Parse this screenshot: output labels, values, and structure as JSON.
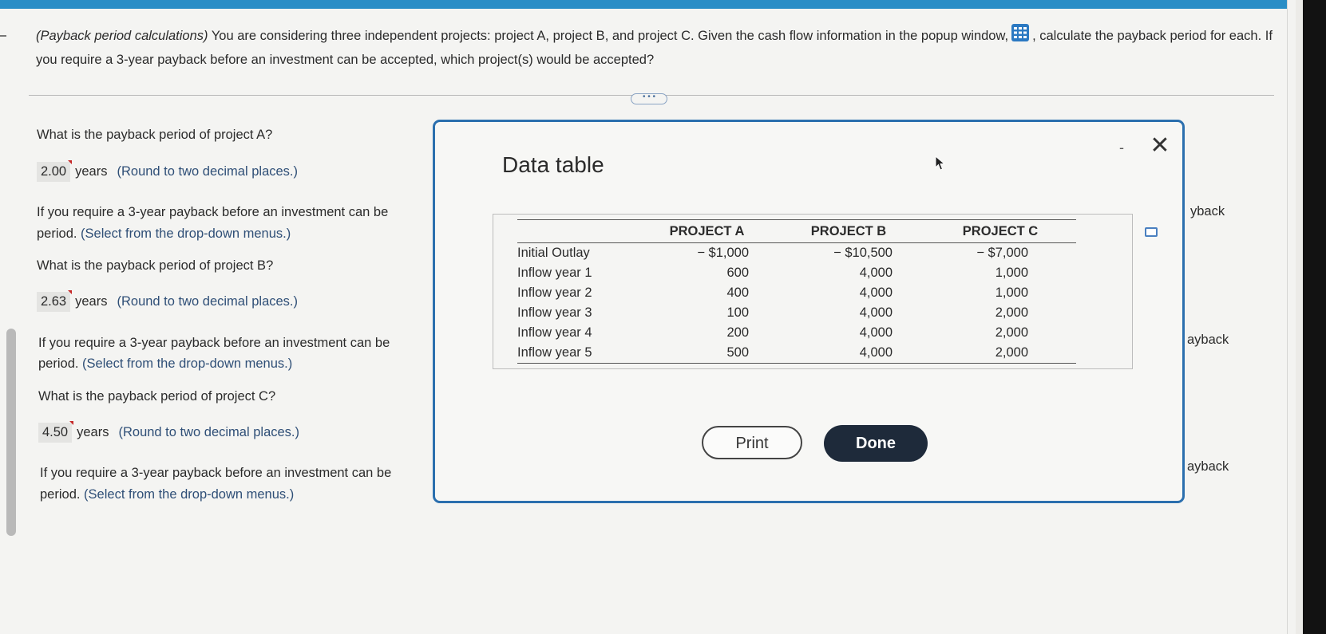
{
  "question": {
    "title_italic": "(Payback period calculations)",
    "text_before_icon": " You are considering three independent projects: project A, project B, and project C. Given the cash flow information in the popup window,",
    "text_after_icon": ", calculate the payback period for each. If you require a 3-year payback before an investment can be accepted, which project(s) would be accepted?"
  },
  "ellipsis": "• • •",
  "parts": [
    {
      "question": "What is the payback period of project A?",
      "answer": "2.00",
      "unit": "years",
      "hint": "(Round to two decimal places.)",
      "followup_line1": "If you require a 3-year payback before an investment can be",
      "followup_line2_a": "period.",
      "followup_line2_b": "(Select from the drop-down menus.)",
      "right_fragment": "yback"
    },
    {
      "question": "What is the payback period of project B?",
      "answer": "2.63",
      "unit": "years",
      "hint": "(Round to two decimal places.)",
      "followup_line1": "If you require a 3-year payback before an investment can be",
      "followup_line2_a": "period.",
      "followup_line2_b": "(Select from the drop-down menus.)",
      "right_fragment": "ayback"
    },
    {
      "question": "What is the payback period of project C?",
      "answer": "4.50",
      "unit": "years",
      "hint": "(Round to two decimal places.)",
      "followup_line1": "If you require a 3-year payback before an investment can be",
      "followup_line2_a": "period.",
      "followup_line2_b": "(Select from the drop-down menus.)",
      "right_fragment": "ayback"
    }
  ],
  "modal": {
    "title": "Data table",
    "minimize": "-",
    "close": "✕",
    "table": {
      "headers": [
        "",
        "PROJECT A",
        "PROJECT B",
        "PROJECT C"
      ],
      "rows": [
        [
          "Initial Outlay",
          "− $1,000",
          "− $10,500",
          "− $7,000"
        ],
        [
          "Inflow year 1",
          "600",
          "4,000",
          "1,000"
        ],
        [
          "Inflow year 2",
          "400",
          "4,000",
          "1,000"
        ],
        [
          "Inflow year 3",
          "100",
          "4,000",
          "2,000"
        ],
        [
          "Inflow year 4",
          "200",
          "4,000",
          "2,000"
        ],
        [
          "Inflow year 5",
          "500",
          "4,000",
          "2,000"
        ]
      ]
    },
    "print_label": "Print",
    "done_label": "Done"
  },
  "colors": {
    "accent_blue": "#2b6fae",
    "hint_blue": "#2f4f77",
    "done_button": "#1e2a3a",
    "top_bar": "#2a8ec6"
  }
}
